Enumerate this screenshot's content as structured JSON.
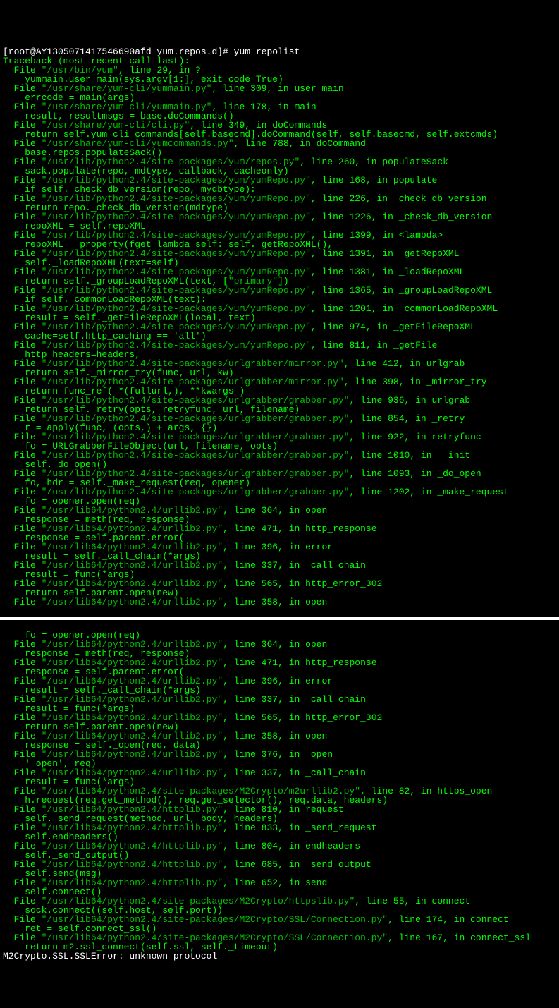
{
  "prompt": {
    "user_host": "[root@AY1305071417546690afd yum.repos.d]# ",
    "command": "yum repolist"
  },
  "top": {
    "header": "Traceback (most recent call last):",
    "lines": [
      "  File \"/usr/bin/yum\", line 29, in ?",
      "    yummain.user_main(sys.argv[1:], exit_code=True)",
      "  File \"/usr/share/yum-cli/yummain.py\", line 309, in user_main",
      "    errcode = main(args)",
      "  File \"/usr/share/yum-cli/yummain.py\", line 178, in main",
      "    result, resultmsgs = base.doCommands()",
      "  File \"/usr/share/yum-cli/cli.py\", line 349, in doCommands",
      "    return self.yum_cli_commands[self.basecmd].doCommand(self, self.basecmd, self.extcmds)",
      "  File \"/usr/share/yum-cli/yumcommands.py\", line 788, in doCommand",
      "    base.repos.populateSack()",
      "  File \"/usr/lib/python2.4/site-packages/yum/repos.py\", line 260, in populateSack",
      "    sack.populate(repo, mdtype, callback, cacheonly)",
      "  File \"/usr/lib/python2.4/site-packages/yum/yumRepo.py\", line 168, in populate",
      "    if self._check_db_version(repo, mydbtype):",
      "  File \"/usr/lib/python2.4/site-packages/yum/yumRepo.py\", line 226, in _check_db_version",
      "    return repo._check_db_version(mdtype)",
      "  File \"/usr/lib/python2.4/site-packages/yum/yumRepo.py\", line 1226, in _check_db_version",
      "    repoXML = self.repoXML",
      "  File \"/usr/lib/python2.4/site-packages/yum/yumRepo.py\", line 1399, in <lambda>",
      "    repoXML = property(fget=lambda self: self._getRepoXML(),",
      "  File \"/usr/lib/python2.4/site-packages/yum/yumRepo.py\", line 1391, in _getRepoXML",
      "    self._loadRepoXML(text=self)",
      "  File \"/usr/lib/python2.4/site-packages/yum/yumRepo.py\", line 1381, in _loadRepoXML",
      "    return self._groupLoadRepoXML(text, [\"primary\"])",
      "  File \"/usr/lib/python2.4/site-packages/yum/yumRepo.py\", line 1365, in _groupLoadRepoXML",
      "    if self._commonLoadRepoXML(text):",
      "  File \"/usr/lib/python2.4/site-packages/yum/yumRepo.py\", line 1201, in _commonLoadRepoXML",
      "    result = self._getFileRepoXML(local, text)",
      "  File \"/usr/lib/python2.4/site-packages/yum/yumRepo.py\", line 974, in _getFileRepoXML",
      "    cache=self.http_caching == 'all')",
      "  File \"/usr/lib/python2.4/site-packages/yum/yumRepo.py\", line 811, in _getFile",
      "    http_headers=headers,",
      "  File \"/usr/lib/python2.4/site-packages/urlgrabber/mirror.py\", line 412, in urlgrab",
      "    return self._mirror_try(func, url, kw)",
      "  File \"/usr/lib/python2.4/site-packages/urlgrabber/mirror.py\", line 398, in _mirror_try",
      "    return func_ref( *(fullurl,), **kwargs )",
      "  File \"/usr/lib/python2.4/site-packages/urlgrabber/grabber.py\", line 936, in urlgrab",
      "    return self._retry(opts, retryfunc, url, filename)",
      "  File \"/usr/lib/python2.4/site-packages/urlgrabber/grabber.py\", line 854, in _retry",
      "    r = apply(func, (opts,) + args, {})",
      "  File \"/usr/lib/python2.4/site-packages/urlgrabber/grabber.py\", line 922, in retryfunc",
      "    fo = URLGrabberFileObject(url, filename, opts)",
      "  File \"/usr/lib/python2.4/site-packages/urlgrabber/grabber.py\", line 1010, in __init__",
      "    self._do_open()",
      "  File \"/usr/lib/python2.4/site-packages/urlgrabber/grabber.py\", line 1093, in _do_open",
      "    fo, hdr = self._make_request(req, opener)",
      "  File \"/usr/lib/python2.4/site-packages/urlgrabber/grabber.py\", line 1202, in _make_request",
      "    fo = opener.open(req)",
      "  File \"/usr/lib64/python2.4/urllib2.py\", line 364, in open",
      "    response = meth(req, response)",
      "  File \"/usr/lib64/python2.4/urllib2.py\", line 471, in http_response",
      "    response = self.parent.error(",
      "  File \"/usr/lib64/python2.4/urllib2.py\", line 396, in error",
      "    result = self._call_chain(*args)",
      "  File \"/usr/lib64/python2.4/urllib2.py\", line 337, in _call_chain",
      "    result = func(*args)",
      "  File \"/usr/lib64/python2.4/urllib2.py\", line 565, in http_error_302",
      "    return self.parent.open(new)",
      "  File \"/usr/lib64/python2.4/urllib2.py\", line 358, in open"
    ]
  },
  "bottom": {
    "lines": [
      "    fo = opener.open(req)",
      "  File \"/usr/lib64/python2.4/urllib2.py\", line 364, in open",
      "    response = meth(req, response)",
      "  File \"/usr/lib64/python2.4/urllib2.py\", line 471, in http_response",
      "    response = self.parent.error(",
      "  File \"/usr/lib64/python2.4/urllib2.py\", line 396, in error",
      "    result = self._call_chain(*args)",
      "  File \"/usr/lib64/python2.4/urllib2.py\", line 337, in _call_chain",
      "    result = func(*args)",
      "  File \"/usr/lib64/python2.4/urllib2.py\", line 565, in http_error_302",
      "    return self.parent.open(new)",
      "  File \"/usr/lib64/python2.4/urllib2.py\", line 358, in open",
      "    response = self._open(req, data)",
      "  File \"/usr/lib64/python2.4/urllib2.py\", line 376, in _open",
      "    '_open', req)",
      "  File \"/usr/lib64/python2.4/urllib2.py\", line 337, in _call_chain",
      "    result = func(*args)",
      "  File \"/usr/lib64/python2.4/site-packages/M2Crypto/m2urllib2.py\", line 82, in https_open",
      "    h.request(req.get_method(), req.get_selector(), req.data, headers)",
      "  File \"/usr/lib64/python2.4/httplib.py\", line 810, in request",
      "    self._send_request(method, url, body, headers)",
      "  File \"/usr/lib64/python2.4/httplib.py\", line 833, in _send_request",
      "    self.endheaders()",
      "  File \"/usr/lib64/python2.4/httplib.py\", line 804, in endheaders",
      "    self._send_output()",
      "  File \"/usr/lib64/python2.4/httplib.py\", line 685, in _send_output",
      "    self.send(msg)",
      "  File \"/usr/lib64/python2.4/httplib.py\", line 652, in send",
      "    self.connect()",
      "  File \"/usr/lib64/python2.4/site-packages/M2Crypto/httpslib.py\", line 55, in connect",
      "    sock.connect((self.host, self.port))",
      "  File \"/usr/lib64/python2.4/site-packages/M2Crypto/SSL/Connection.py\", line 174, in connect",
      "    ret = self.connect_ssl()",
      "  File \"/usr/lib64/python2.4/site-packages/M2Crypto/SSL/Connection.py\", line 167, in connect_ssl",
      "    return m2.ssl_connect(self.ssl, self._timeout)"
    ],
    "error": "M2Crypto.SSL.SSLError: unknown protocol"
  }
}
